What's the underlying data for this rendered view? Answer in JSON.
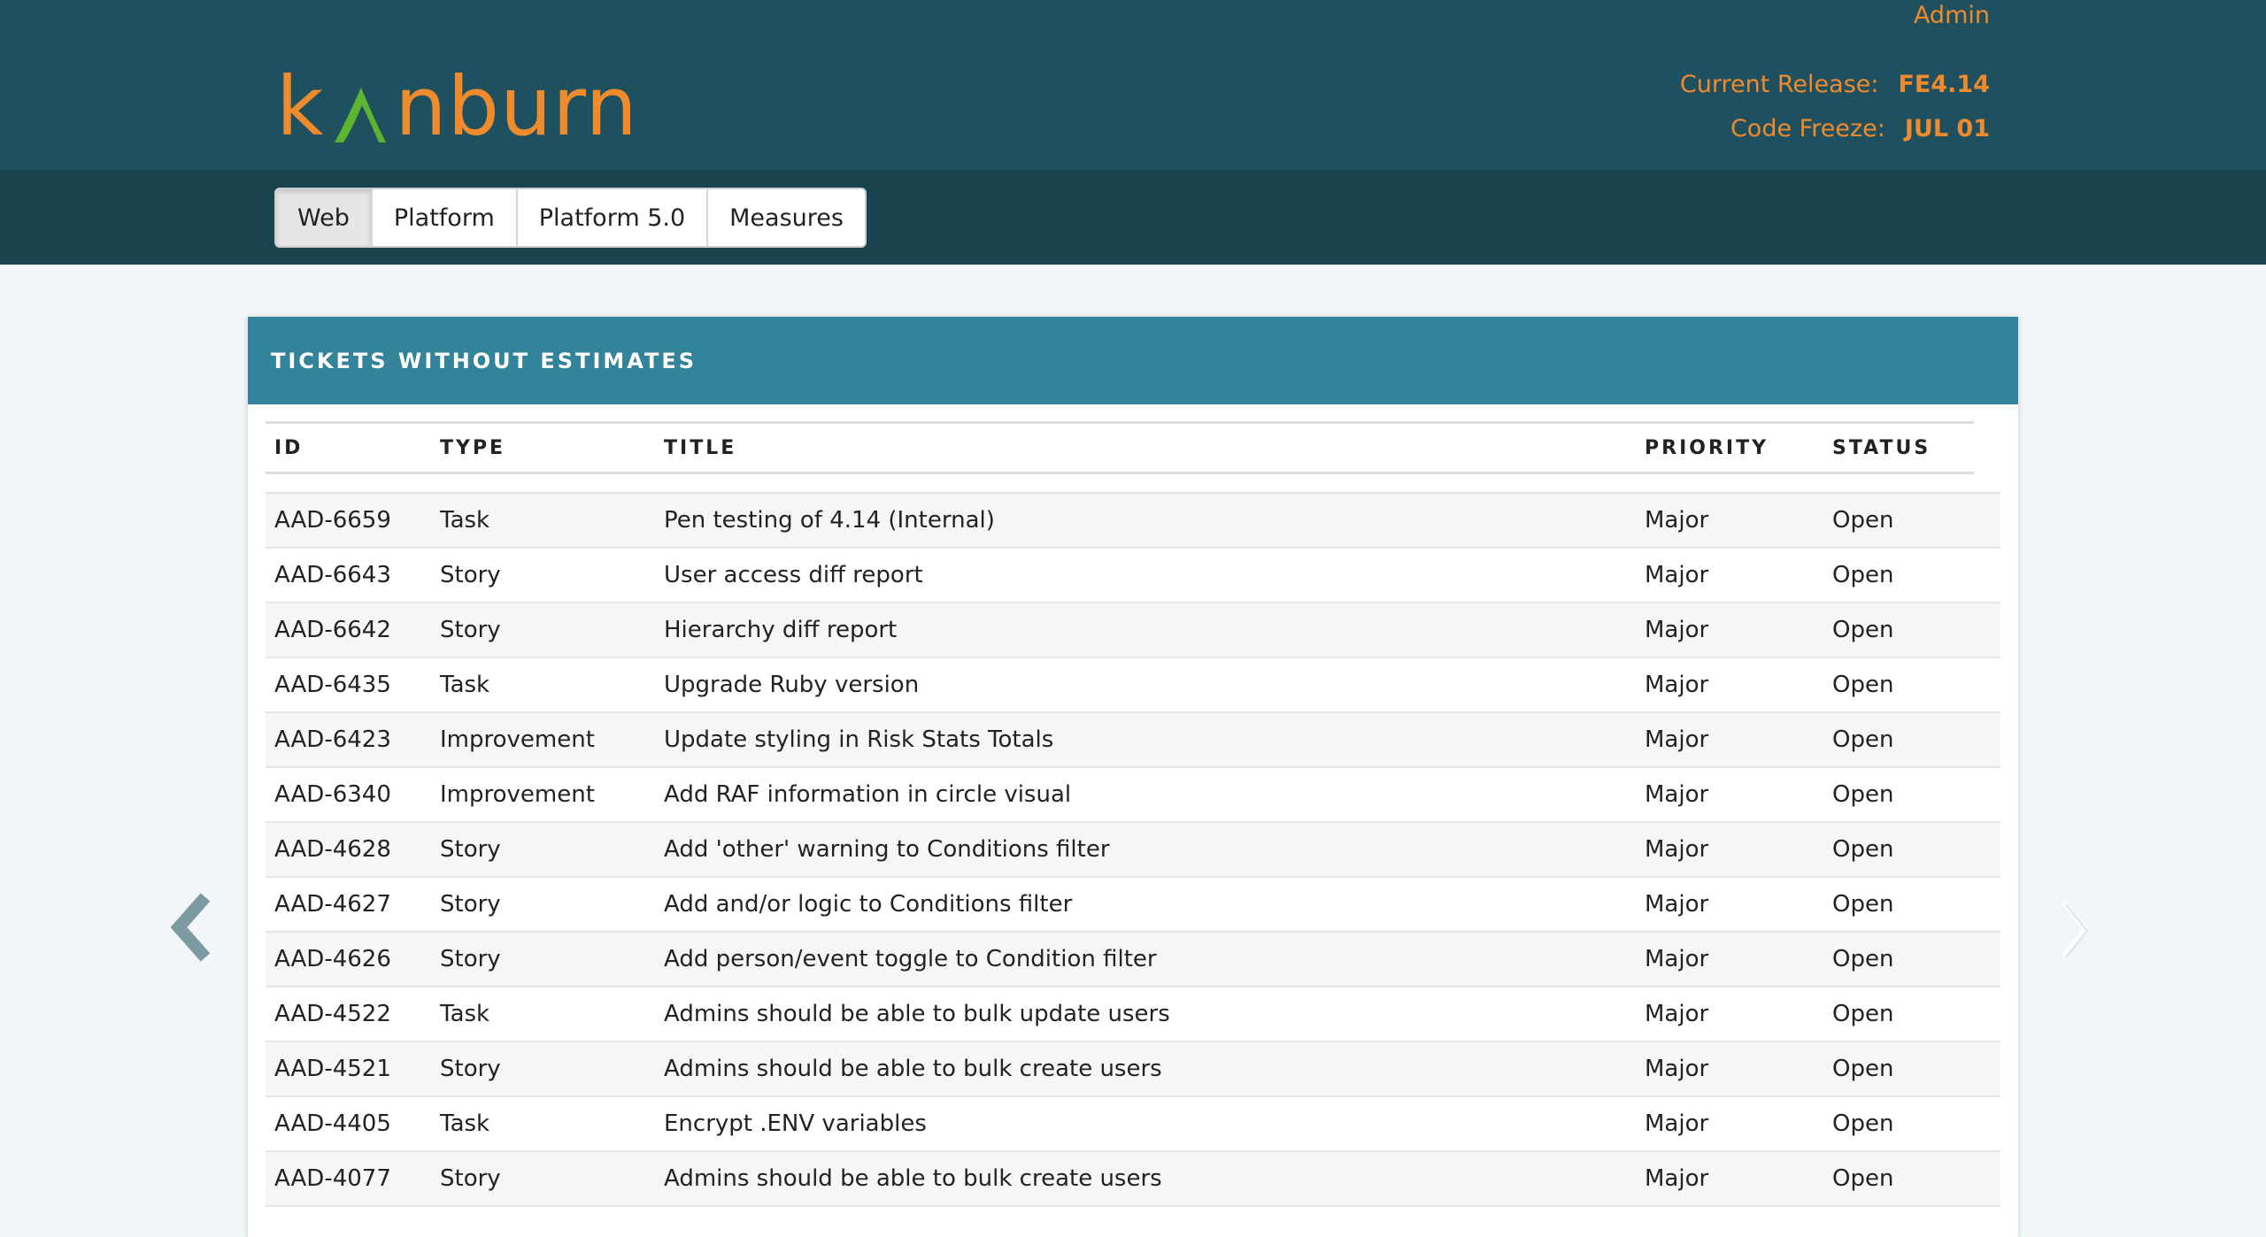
{
  "header": {
    "logo_text_1": "k",
    "logo_text_2": "nburn",
    "admin_label": "Admin",
    "current_release_label": "Current Release:",
    "current_release_value": "FE4.14",
    "code_freeze_label": "Code Freeze:",
    "code_freeze_value": "JUL 01"
  },
  "tabs": [
    {
      "label": "Web",
      "active": true
    },
    {
      "label": "Platform",
      "active": false
    },
    {
      "label": "Platform 5.0",
      "active": false
    },
    {
      "label": "Measures",
      "active": false
    }
  ],
  "panel": {
    "title": "TICKETS WITHOUT ESTIMATES",
    "columns": [
      "ID",
      "TYPE",
      "TITLE",
      "PRIORITY",
      "STATUS"
    ],
    "rows": [
      {
        "id": "AAD-6659",
        "type": "Task",
        "title": "Pen testing of 4.14 (Internal)",
        "priority": "Major",
        "status": "Open"
      },
      {
        "id": "AAD-6643",
        "type": "Story",
        "title": "User access diff report",
        "priority": "Major",
        "status": "Open"
      },
      {
        "id": "AAD-6642",
        "type": "Story",
        "title": "Hierarchy diff report",
        "priority": "Major",
        "status": "Open"
      },
      {
        "id": "AAD-6435",
        "type": "Task",
        "title": "Upgrade Ruby version",
        "priority": "Major",
        "status": "Open"
      },
      {
        "id": "AAD-6423",
        "type": "Improvement",
        "title": "Update styling in Risk Stats Totals",
        "priority": "Major",
        "status": "Open"
      },
      {
        "id": "AAD-6340",
        "type": "Improvement",
        "title": "Add RAF information in circle visual",
        "priority": "Major",
        "status": "Open"
      },
      {
        "id": "AAD-4628",
        "type": "Story",
        "title": "Add 'other' warning to Conditions filter",
        "priority": "Major",
        "status": "Open"
      },
      {
        "id": "AAD-4627",
        "type": "Story",
        "title": "Add and/or logic to Conditions filter",
        "priority": "Major",
        "status": "Open"
      },
      {
        "id": "AAD-4626",
        "type": "Story",
        "title": "Add person/event toggle to Condition filter",
        "priority": "Major",
        "status": "Open"
      },
      {
        "id": "AAD-4522",
        "type": "Task",
        "title": "Admins should be able to bulk update users",
        "priority": "Major",
        "status": "Open"
      },
      {
        "id": "AAD-4521",
        "type": "Story",
        "title": "Admins should be able to bulk create users",
        "priority": "Major",
        "status": "Open"
      },
      {
        "id": "AAD-4405",
        "type": "Task",
        "title": "Encrypt .ENV variables",
        "priority": "Major",
        "status": "Open"
      },
      {
        "id": "AAD-4077",
        "type": "Story",
        "title": "Admins should be able to bulk create users",
        "priority": "Major",
        "status": "Open"
      }
    ]
  },
  "icons": {
    "logo_mark": "mountain-peak-icon",
    "prev": "chevron-left-icon",
    "next": "chevron-right-icon"
  },
  "colors": {
    "header_bg": "#1f5060",
    "nav_bg": "#1a4350",
    "accent_orange": "#ef8b2c",
    "logo_green": "#5cb531",
    "panel_header": "#33839b"
  }
}
